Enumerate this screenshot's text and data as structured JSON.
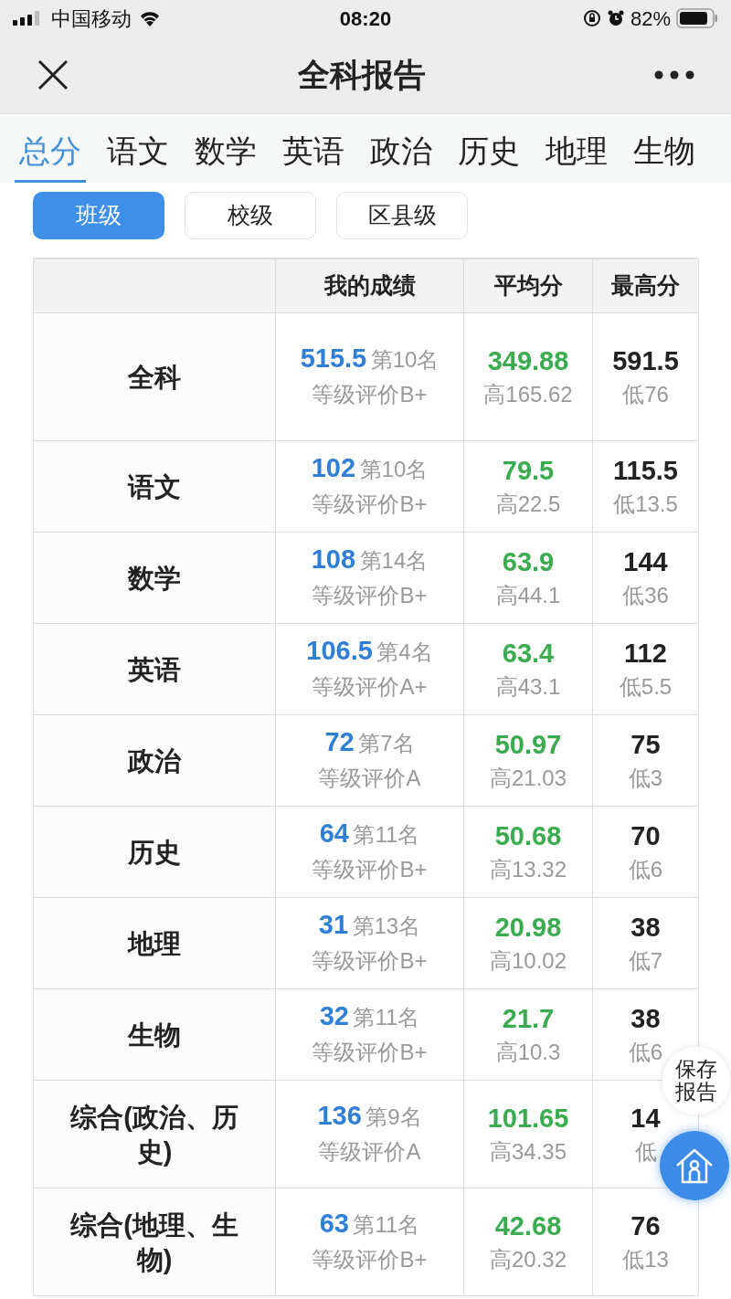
{
  "status_bar": {
    "carrier": "中国移动",
    "time": "08:20",
    "battery": "82%"
  },
  "nav": {
    "title": "全科报告"
  },
  "tabs": [
    {
      "label": "总分",
      "selected": true
    },
    {
      "label": "语文",
      "selected": false
    },
    {
      "label": "数学",
      "selected": false
    },
    {
      "label": "英语",
      "selected": false
    },
    {
      "label": "政治",
      "selected": false
    },
    {
      "label": "历史",
      "selected": false
    },
    {
      "label": "地理",
      "selected": false
    },
    {
      "label": "生物",
      "selected": false
    }
  ],
  "scopes": [
    {
      "label": "班级",
      "selected": true
    },
    {
      "label": "校级",
      "selected": false
    },
    {
      "label": "区县级",
      "selected": false
    }
  ],
  "table": {
    "columns": [
      "我的成绩",
      "平均分",
      "最高分"
    ],
    "rows": [
      {
        "subject": "全科",
        "score": "515.5",
        "rank": "第10名",
        "grade": "等级评价B+",
        "average": "349.88",
        "avg_gap": "高165.62",
        "max": "591.5",
        "max_gap": "低76"
      },
      {
        "subject": "语文",
        "score": "102",
        "rank": "第10名",
        "grade": "等级评价B+",
        "average": "79.5",
        "avg_gap": "高22.5",
        "max": "115.5",
        "max_gap": "低13.5"
      },
      {
        "subject": "数学",
        "score": "108",
        "rank": "第14名",
        "grade": "等级评价B+",
        "average": "63.9",
        "avg_gap": "高44.1",
        "max": "144",
        "max_gap": "低36"
      },
      {
        "subject": "英语",
        "score": "106.5",
        "rank": "第4名",
        "grade": "等级评价A+",
        "average": "63.4",
        "avg_gap": "高43.1",
        "max": "112",
        "max_gap": "低5.5"
      },
      {
        "subject": "政治",
        "score": "72",
        "rank": "第7名",
        "grade": "等级评价A",
        "average": "50.97",
        "avg_gap": "高21.03",
        "max": "75",
        "max_gap": "低3"
      },
      {
        "subject": "历史",
        "score": "64",
        "rank": "第11名",
        "grade": "等级评价B+",
        "average": "50.68",
        "avg_gap": "高13.32",
        "max": "70",
        "max_gap": "低6"
      },
      {
        "subject": "地理",
        "score": "31",
        "rank": "第13名",
        "grade": "等级评价B+",
        "average": "20.98",
        "avg_gap": "高10.02",
        "max": "38",
        "max_gap": "低7"
      },
      {
        "subject": "生物",
        "score": "32",
        "rank": "第11名",
        "grade": "等级评价B+",
        "average": "21.7",
        "avg_gap": "高10.3",
        "max": "38",
        "max_gap": "低6"
      },
      {
        "subject": "综合(政治、历史)",
        "score": "136",
        "rank": "第9名",
        "grade": "等级评价A",
        "average": "101.65",
        "avg_gap": "高34.35",
        "max": "14",
        "max_gap": "低"
      },
      {
        "subject": "综合(地理、生物)",
        "score": "63",
        "rank": "第11名",
        "grade": "等级评价B+",
        "average": "42.68",
        "avg_gap": "高20.32",
        "max": "76",
        "max_gap": "低13"
      }
    ]
  },
  "float_buttons": {
    "save": "保存报告"
  }
}
